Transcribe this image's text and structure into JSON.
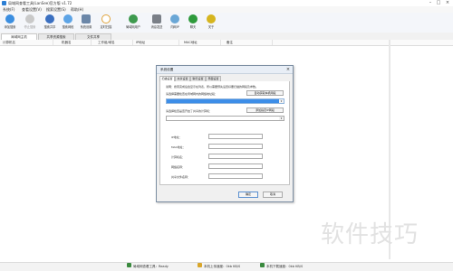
{
  "window": {
    "title": "局域网查看工具(LanSee)官方版 v1.72"
  },
  "menu": [
    "系统(F)",
    "查看设置(V)",
    "搜索设置(S)",
    "帮助(H)"
  ],
  "toolbar": [
    {
      "label": "添加搜索",
      "icon": "add-icon",
      "color": "#3b8ee0"
    },
    {
      "label": "停止搜索",
      "icon": "stop-icon",
      "color": "#c9c9c9"
    },
    {
      "label": "搜索共享",
      "icon": "share-icon",
      "color": "#3a6fc0"
    },
    {
      "label": "搜索网段",
      "icon": "network-icon",
      "color": "#5da4e6"
    },
    {
      "label": "系统设置",
      "icon": "settings-icon",
      "color": "#6c87a8"
    },
    {
      "label": "定时扫描",
      "icon": "clock-icon",
      "color": "#e0a33a"
    },
    {
      "label": "局域网用户",
      "icon": "users-icon",
      "color": "#3e9a4e"
    },
    {
      "label": "消息发送",
      "icon": "message-icon",
      "color": "#7a7f87"
    },
    {
      "label": "内网IP",
      "icon": "ip-icon",
      "color": "#6aa7d6"
    },
    {
      "label": "聊天",
      "icon": "chat-icon",
      "color": "#2e9a3c"
    },
    {
      "label": "关于",
      "icon": "about-icon",
      "color": "#d6b51f"
    }
  ],
  "tabs": [
    "局域网主机",
    "共享资源搜索",
    "文件共享"
  ],
  "columns": [
    "计算机名",
    "机器名",
    "工作组/域名",
    "IP地址",
    "MAC地址",
    "备注"
  ],
  "status": {
    "ready": "局域网查看工具：Ready",
    "upload": "本机上传速度：0kb KB/S",
    "download": "本机下载速度：0kb KB/S"
  },
  "dialog": {
    "title": "系统设置",
    "tabs": [
      "扫描设置",
      "共享设置",
      "聊天设置",
      "界面设置"
    ],
    "hint": "说明：搜索完成后会显示在列表，所以需要预先设置好要扫描的网段及参数。",
    "range1_label": "请选择需要检查在局域网内的网络地址段：",
    "range1_button": "自动获取本机网段",
    "range1_value": "",
    "range2_label": "请选择检查是否开启了共享的计算机：",
    "range2_button": "添加指定IP网段",
    "range2_value": "",
    "fields": [
      {
        "label": "IP地址：",
        "value": ""
      },
      {
        "label": "MAC地址：",
        "value": ""
      },
      {
        "label": "计算机名：",
        "value": ""
      },
      {
        "label": "网络名称：",
        "value": ""
      },
      {
        "label": "共享文件名称：",
        "value": ""
      }
    ],
    "ok": "确定",
    "cancel": "取消"
  },
  "watermark": "软件技巧",
  "colors": {
    "accent": "#3d8ee8",
    "dialog_border": "#7d8fa3"
  }
}
